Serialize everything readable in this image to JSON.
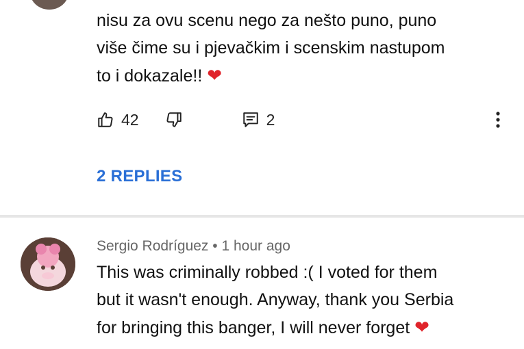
{
  "comment1": {
    "text": "nisu za ovu scenu nego za nešto puno, puno\nviše čime su i pjevačkim i scenskim nastupom\nto i dokazale!!",
    "like_count": "42",
    "reply_count": "2",
    "replies_link": "2 REPLIES",
    "icons": [
      "thumbs-up-icon",
      "thumbs-down-icon",
      "reply-icon",
      "more-icon"
    ]
  },
  "comment2": {
    "author": "Sergio Rodríguez",
    "separator": "•",
    "time": "1 hour ago",
    "text": "This was criminally robbed :(  I voted for them\nbut it wasn't enough. Anyway, thank you Serbia\nfor bringing this banger, I will never forget"
  },
  "colors": {
    "link": "#2a6fd6",
    "heart": "#e0242b",
    "divider": "#e6e6e6"
  }
}
